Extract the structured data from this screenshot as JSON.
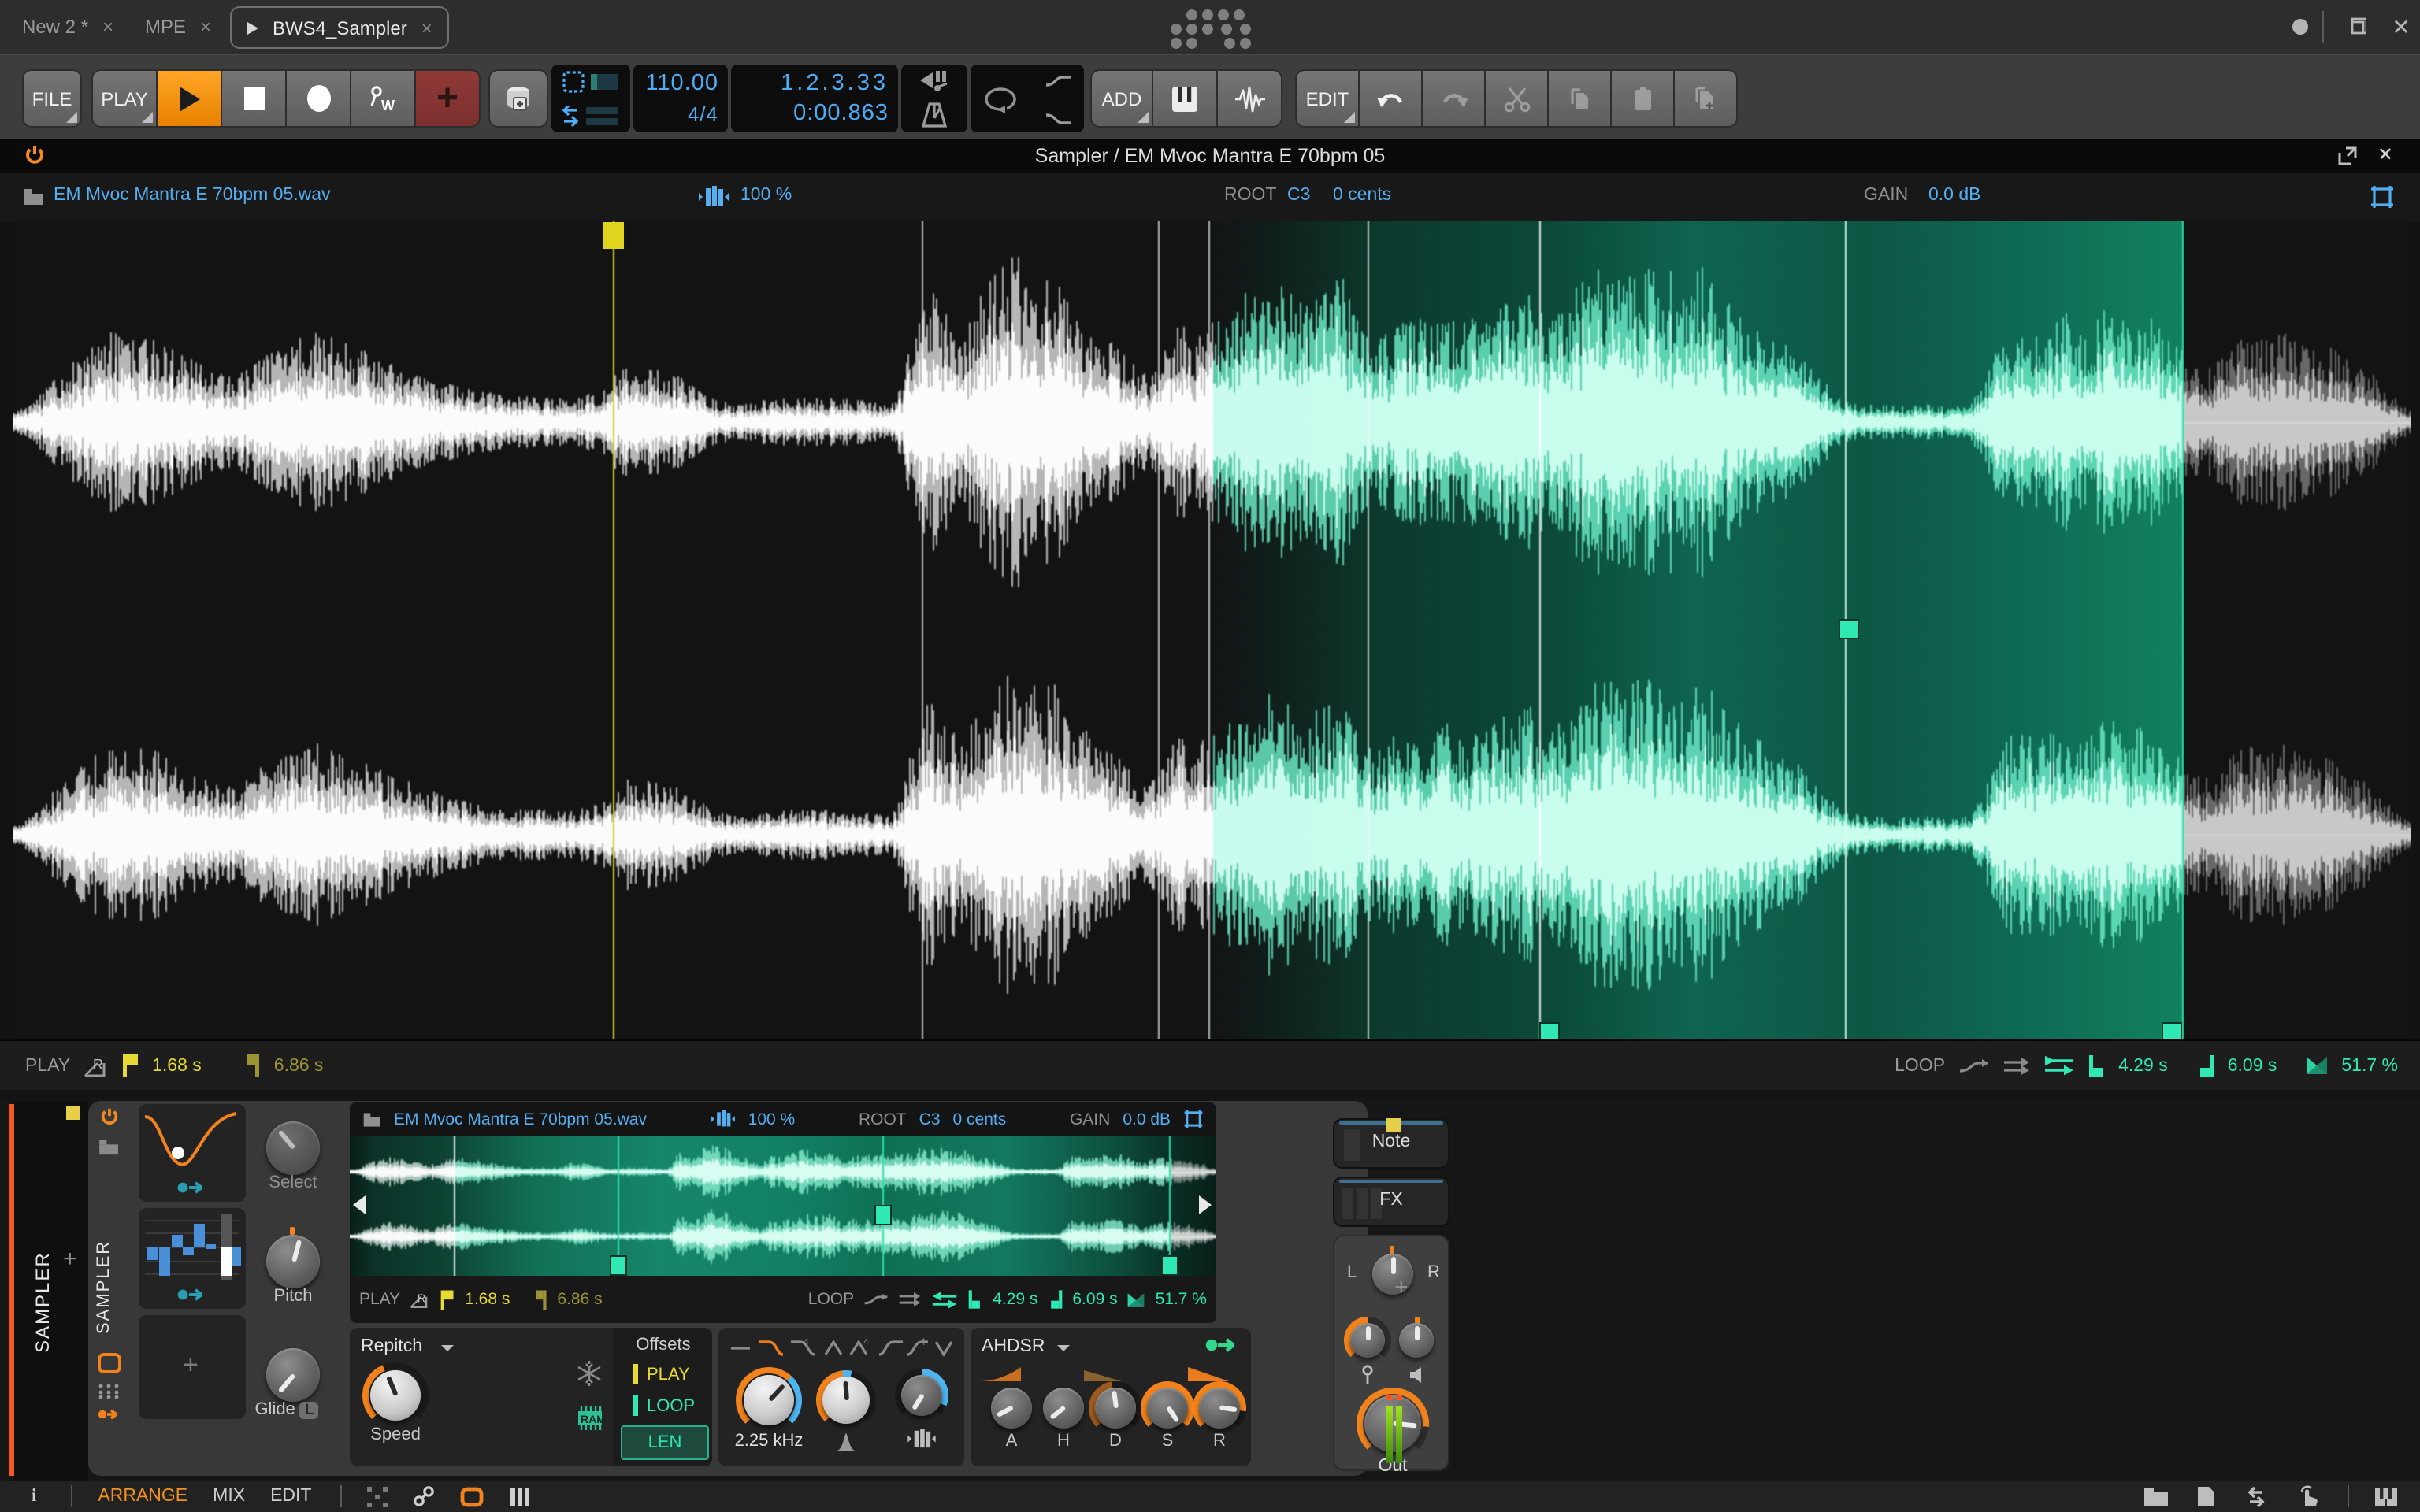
{
  "titlebar": {
    "tabs": [
      {
        "label": "New 2 *"
      },
      {
        "label": "MPE"
      },
      {
        "label": "BWS4_Sampler"
      }
    ],
    "close_glyph": "×"
  },
  "toolbar": {
    "file": "FILE",
    "play": "PLAY",
    "add": "ADD",
    "edit": "EDIT",
    "tempo": "110.00",
    "time_signature": "4/4",
    "position": "1.2.3.33",
    "time": "0:00.863"
  },
  "sampler": {
    "title": "Sampler / EM Mvoc Mantra E 70bpm 05",
    "file_name": "EM Mvoc Mantra E 70bpm 05.wav",
    "stretch_amount": "100 %",
    "root_label": "ROOT",
    "root_note": "C3",
    "root_fine": "0 cents",
    "gain_label": "GAIN",
    "gain_value": "0.0 dB",
    "play_label": "PLAY",
    "play_start": "1.68 s",
    "play_end": "6.86 s",
    "loop_label": "LOOP",
    "loop_start": "4.29 s",
    "loop_end": "6.09 s",
    "loop_crossfade": "51.7 %"
  },
  "device": {
    "track_name": "SAMPLER",
    "device_name": "SAMPLER",
    "mode": "Repitch",
    "knobs": {
      "select": "Select",
      "pitch": "Pitch",
      "glide": "Glide",
      "speed": "Speed",
      "out": "Out"
    },
    "glide_badge": "L",
    "ram_label": "RAM",
    "offsets": {
      "title": "Offsets",
      "play": "PLAY",
      "loop": "LOOP",
      "len": "LEN"
    },
    "filter_freq": "2.25 kHz",
    "envelope": {
      "name": "AHDSR",
      "a": "A",
      "h": "H",
      "d": "D",
      "s": "S",
      "r": "R"
    },
    "pan": {
      "left": "L",
      "right": "R"
    },
    "tabs": {
      "note": "Note",
      "fx": "FX"
    }
  },
  "statusbar": {
    "views": [
      "ARRANGE",
      "MIX",
      "EDIT"
    ]
  }
}
